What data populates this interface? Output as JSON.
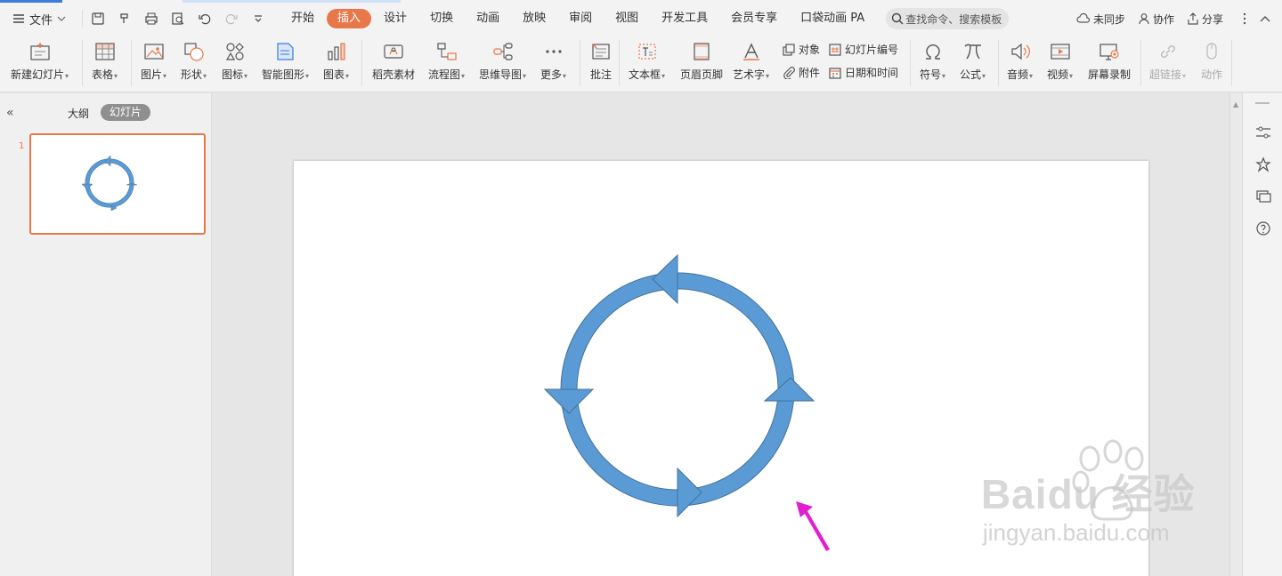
{
  "menubar": {
    "file_label": "文件",
    "tabs": [
      "开始",
      "插入",
      "设计",
      "切换",
      "动画",
      "放映",
      "审阅",
      "视图",
      "开发工具",
      "会员专享",
      "口袋动画 PA"
    ],
    "active_tab": "插入",
    "search_placeholder": "查找命令、搜索模板",
    "sync_label": "未同步",
    "collab_label": "协作",
    "share_label": "分享"
  },
  "ribbon": {
    "new_slide": "新建幻灯片",
    "table": "表格",
    "picture": "图片",
    "shape": "形状",
    "icon": "图标",
    "smart_graphic": "智能图形",
    "chart": "图表",
    "daoke": "稻壳素材",
    "flowchart": "流程图",
    "mindmap": "思维导图",
    "more": "更多",
    "comment": "批注",
    "textbox": "文本框",
    "header_footer": "页眉页脚",
    "wordart": "艺术字",
    "object": "对象",
    "attachment": "附件",
    "slide_number": "幻灯片编号",
    "datetime": "日期和时间",
    "symbol": "符号",
    "formula": "公式",
    "audio": "音频",
    "video": "视频",
    "screen_record": "屏幕录制",
    "hyperlink": "超链接",
    "action": "动作"
  },
  "leftpanel": {
    "outline_tab": "大纲",
    "slides_tab": "幻灯片",
    "slide_number": "1"
  },
  "watermark": {
    "brand": "Baidu 经验",
    "url": "jingyan.baidu.com"
  },
  "colors": {
    "accent": "#e8784a",
    "shape_fill": "#5b9bd5",
    "shape_stroke": "#41719c",
    "pointer": "#e020d0"
  }
}
